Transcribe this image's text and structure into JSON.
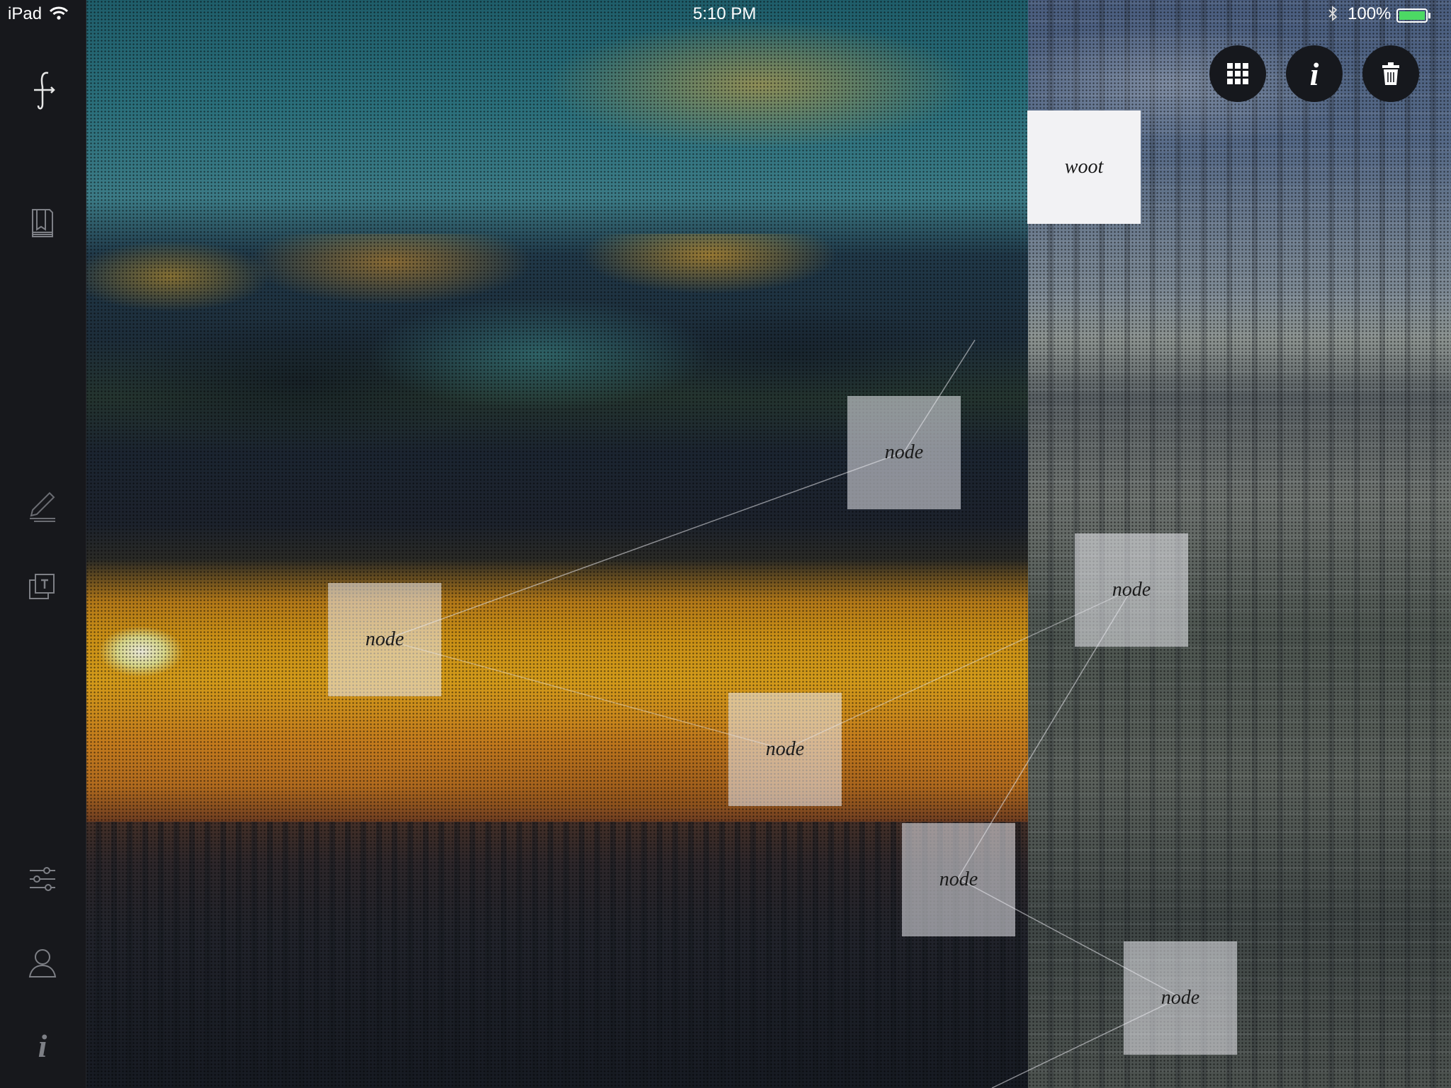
{
  "status_bar": {
    "device": "iPad",
    "time": "5:10 PM",
    "battery": "100%",
    "icons": [
      "wifi-icon",
      "bluetooth-icon",
      "battery-icon"
    ]
  },
  "sidebar": {
    "items": [
      {
        "name": "app-logo",
        "icon": "feather-hook-logo"
      },
      {
        "name": "notebook",
        "icon": "book-icon"
      },
      {
        "name": "draw",
        "icon": "pen-icon"
      },
      {
        "name": "pinned-cards",
        "icon": "pinned-stack-icon"
      },
      {
        "name": "settings",
        "icon": "sliders-icon"
      },
      {
        "name": "account",
        "icon": "user-icon"
      },
      {
        "name": "about",
        "icon": "info-icon",
        "label": "i"
      }
    ]
  },
  "toolbar": {
    "buttons": [
      {
        "name": "grid",
        "icon": "grid-icon"
      },
      {
        "name": "info",
        "icon": "info-icon",
        "label": "i"
      },
      {
        "name": "delete",
        "icon": "trash-icon"
      }
    ]
  },
  "nodes": [
    {
      "label": "woot"
    },
    {
      "label": "node"
    },
    {
      "label": "node"
    },
    {
      "label": "node"
    },
    {
      "label": "node"
    },
    {
      "label": "node"
    },
    {
      "label": "node"
    }
  ],
  "colors": {
    "sidebar": "#17181c",
    "toolbar_button": "#16181d",
    "battery": "#4cd964",
    "node_fill": "#ebebf0"
  }
}
